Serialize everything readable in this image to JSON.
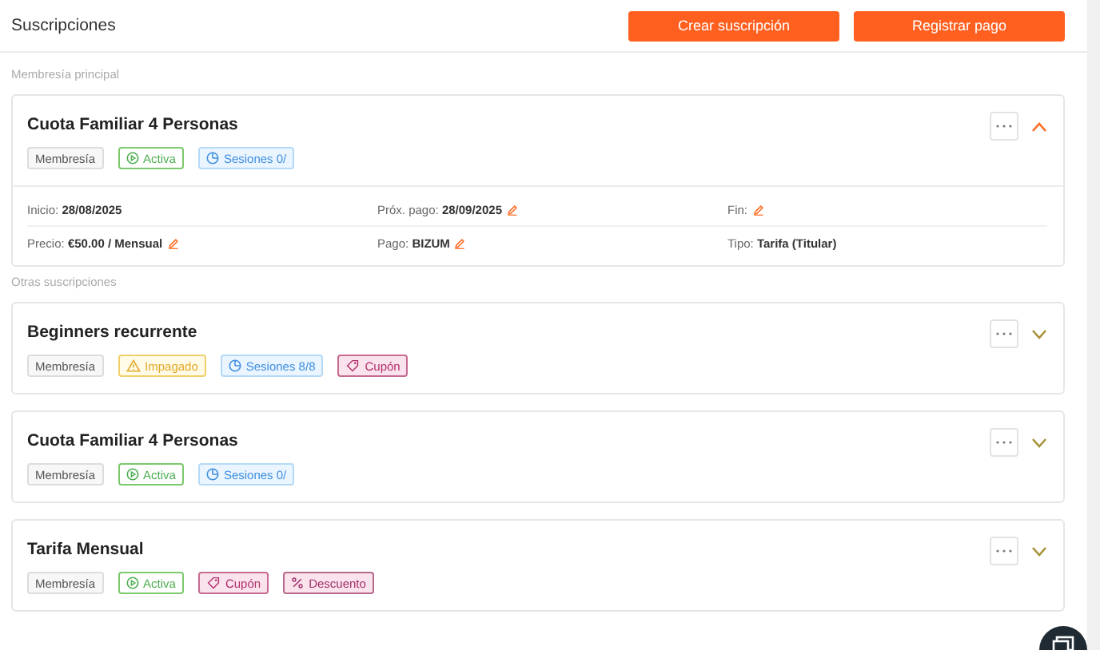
{
  "header": {
    "title": "Suscripciones",
    "buttons": [
      "Crear suscripción",
      "Registrar pago"
    ]
  },
  "main_section": {
    "label": "Membresía principal",
    "subscriptions": [
      {
        "title": "Cuota Familiar 4 Personas",
        "expanded": true,
        "tags": [
          {
            "kind": "plain",
            "label": "Membresía"
          },
          {
            "kind": "active",
            "label": "Activa"
          },
          {
            "kind": "sessions",
            "label": "Sesiones 0/"
          }
        ],
        "details": [
          {
            "label": "Inicio:",
            "value": "28/08/2025",
            "editable": false
          },
          {
            "label": "Próx. pago:",
            "value": "28/09/2025",
            "editable": true
          },
          {
            "label": "Fin:",
            "editable": true
          },
          {
            "label": "Precio:",
            "value": "€50.00 / Mensual",
            "editable": true
          },
          {
            "label": "Pago:",
            "value": "BIZUM",
            "editable": true
          },
          {
            "label": "Tipo:",
            "value": "Tarifa (Titular)",
            "editable": false
          }
        ]
      }
    ]
  },
  "other_section": {
    "label": "Otras suscripciones",
    "subscriptions": [
      {
        "title": "Beginners recurrente",
        "expanded": false,
        "tags": [
          {
            "kind": "plain",
            "label": "Membresía"
          },
          {
            "kind": "unpaid",
            "label": "Impagado"
          },
          {
            "kind": "sessions",
            "label": "Sesiones 8/8"
          },
          {
            "kind": "coupon",
            "label": "Cupón"
          }
        ]
      },
      {
        "title": "Cuota Familiar 4 Personas",
        "expanded": false,
        "tags": [
          {
            "kind": "plain",
            "label": "Membresía"
          },
          {
            "kind": "active",
            "label": "Activa"
          },
          {
            "kind": "sessions",
            "label": "Sesiones 0/"
          }
        ]
      },
      {
        "title": "Tarifa Mensual",
        "expanded": false,
        "tags": [
          {
            "kind": "plain",
            "label": "Membresía"
          },
          {
            "kind": "active",
            "label": "Activa"
          },
          {
            "kind": "coupon",
            "label": "Cupón"
          },
          {
            "kind": "discount",
            "label": "Descuento"
          }
        ]
      }
    ]
  }
}
